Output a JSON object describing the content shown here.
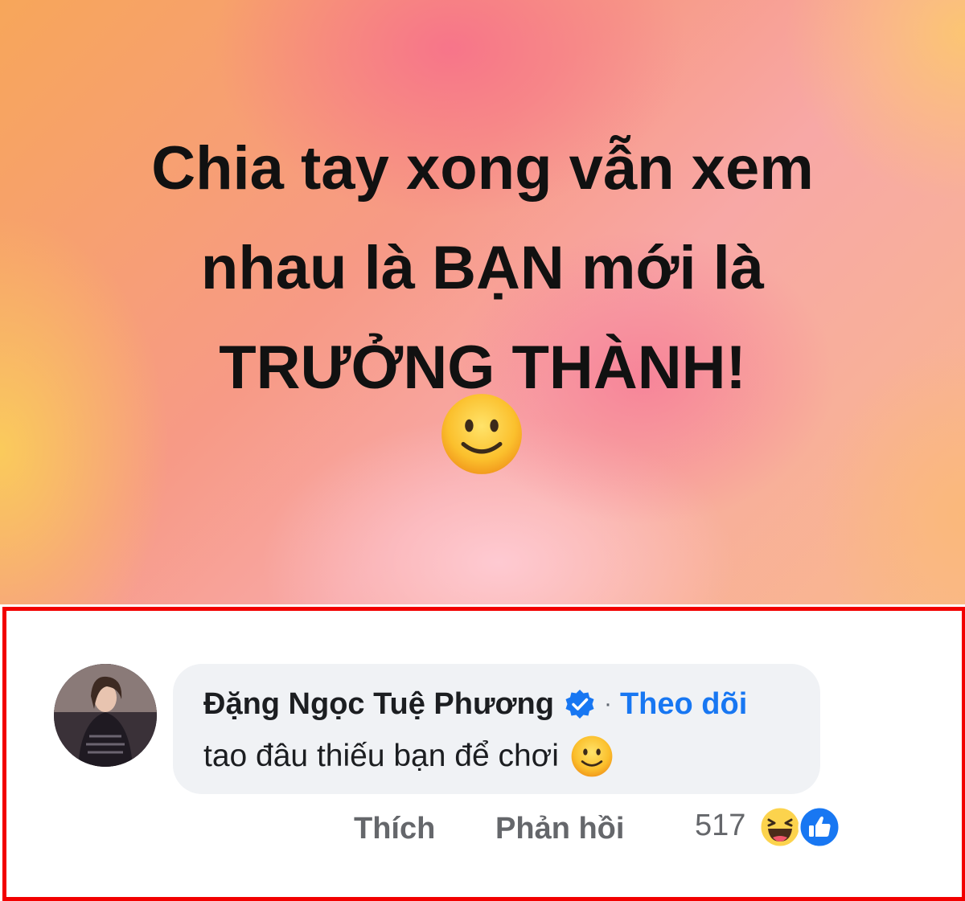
{
  "post": {
    "text": "Chia tay xong vẫn xem\nnhau là BẠN mới là\nTRƯỞNG THÀNH!",
    "emoji_icon": "slightly-smiling-face-icon"
  },
  "comment": {
    "author": "Đặng Ngọc Tuệ Phương",
    "verified_icon": "verified-badge-icon",
    "separator": "·",
    "follow_label": "Theo dõi",
    "text": "tao đâu thiếu bạn để chơi",
    "text_emoji_icon": "slightly-smiling-face-icon",
    "actions": {
      "like_label": "Thích",
      "reply_label": "Phản hồi"
    },
    "reaction_count": "517",
    "reaction_icons": [
      "haha-reaction-icon",
      "like-reaction-icon"
    ]
  },
  "colors": {
    "highlight_border": "#f20000",
    "link_blue": "#1877f2",
    "bubble_bg": "#f0f2f5",
    "muted_text": "#65676b"
  }
}
